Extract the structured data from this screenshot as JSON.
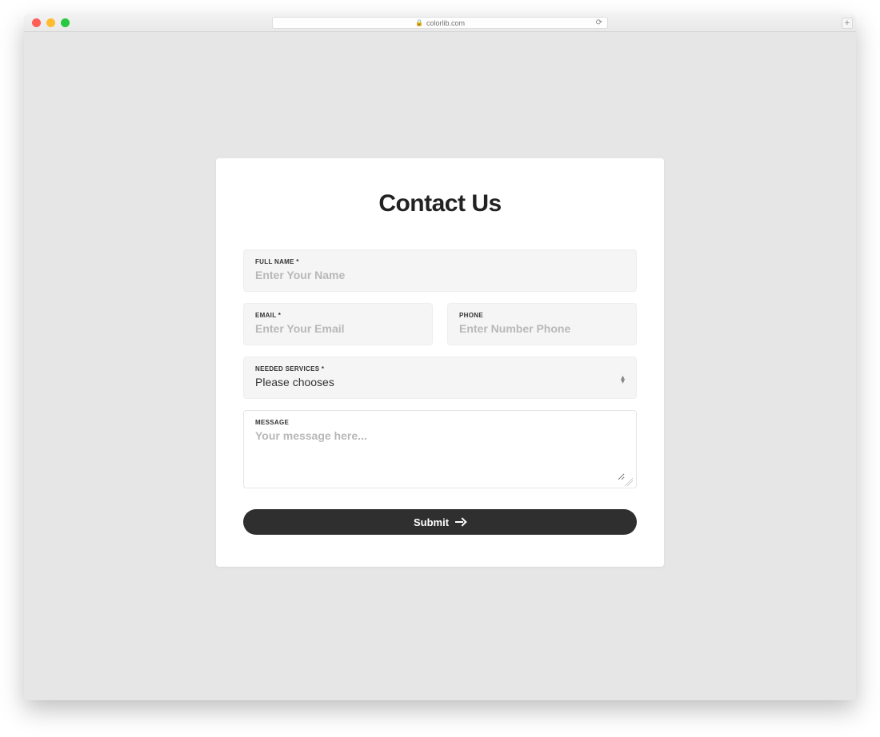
{
  "browser": {
    "url_host": "colorlib.com"
  },
  "form": {
    "title": "Contact Us",
    "full_name": {
      "label": "FULL NAME *",
      "placeholder": "Enter Your Name"
    },
    "email": {
      "label": "EMAIL *",
      "placeholder": "Enter Your Email"
    },
    "phone": {
      "label": "PHONE",
      "placeholder": "Enter Number Phone"
    },
    "services": {
      "label": "NEEDED SERVICES *",
      "selected": "Please chooses"
    },
    "message": {
      "label": "MESSAGE",
      "placeholder": "Your message here..."
    },
    "submit_label": "Submit"
  }
}
